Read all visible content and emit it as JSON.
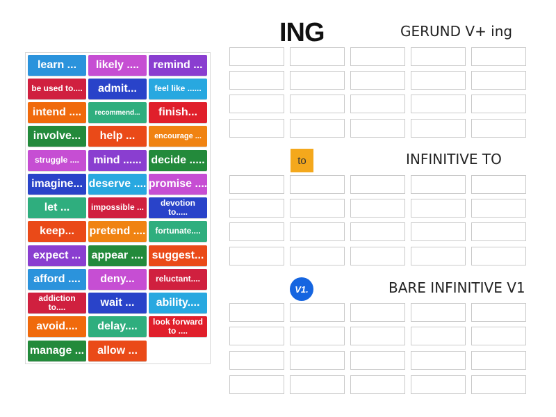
{
  "title": "ING",
  "categories": [
    {
      "label": "GERUND V+ ing"
    },
    {
      "label": "INFINITIVE TO",
      "badge": "to"
    },
    {
      "label": "BARE INFINITIVE V1",
      "badge": "V1."
    }
  ],
  "tiles": [
    {
      "text": "learn ...",
      "color": "#2b93dc"
    },
    {
      "text": "likely ....",
      "color": "#c64ed3"
    },
    {
      "text": "remind ...",
      "color": "#8a3ed0"
    },
    {
      "text": "be used to....",
      "color": "#d0203f"
    },
    {
      "text": "admit...",
      "color": "#2943c9"
    },
    {
      "text": "feel like ......",
      "color": "#28a8e0"
    },
    {
      "text": "intend ....",
      "color": "#f06a0c"
    },
    {
      "text": "recommend...",
      "color": "#2fae7e"
    },
    {
      "text": "finish...",
      "color": "#e01f2b"
    },
    {
      "text": "involve...",
      "color": "#238a3b"
    },
    {
      "text": "help ...",
      "color": "#ea4a18"
    },
    {
      "text": "encourage ...",
      "color": "#f08312"
    },
    {
      "text": "struggle ....",
      "color": "#c64ed3"
    },
    {
      "text": "mind ......",
      "color": "#8a3ed0"
    },
    {
      "text": "decide .....",
      "color": "#238a3b"
    },
    {
      "text": "imagine...",
      "color": "#2943c9"
    },
    {
      "text": "deserve ....",
      "color": "#28a8e0"
    },
    {
      "text": "promise ....",
      "color": "#c64ed3"
    },
    {
      "text": "let ...",
      "color": "#2fae7e"
    },
    {
      "text": "impossible ...",
      "color": "#d0203f"
    },
    {
      "text": "devotion to.....",
      "color": "#2943c9"
    },
    {
      "text": "keep...",
      "color": "#ea4a18"
    },
    {
      "text": "pretend ....",
      "color": "#f08312"
    },
    {
      "text": "fortunate....",
      "color": "#2fae7e"
    },
    {
      "text": "expect ...",
      "color": "#8a3ed0"
    },
    {
      "text": "appear ....",
      "color": "#238a3b"
    },
    {
      "text": "suggest...",
      "color": "#ea4a18"
    },
    {
      "text": "afford ....",
      "color": "#2b93dc"
    },
    {
      "text": "deny...",
      "color": "#c64ed3"
    },
    {
      "text": "reluctant....",
      "color": "#d0203f"
    },
    {
      "text": "addiction to....",
      "color": "#d0203f"
    },
    {
      "text": "wait ...",
      "color": "#2943c9"
    },
    {
      "text": "ability....",
      "color": "#28a8e0"
    },
    {
      "text": "avoid....",
      "color": "#f06a0c"
    },
    {
      "text": "delay....",
      "color": "#2fae7e"
    },
    {
      "text": "look forward to ....",
      "color": "#e01f2b"
    },
    {
      "text": "manage ...",
      "color": "#238a3b"
    },
    {
      "text": "allow ...",
      "color": "#ea4a18"
    }
  ]
}
